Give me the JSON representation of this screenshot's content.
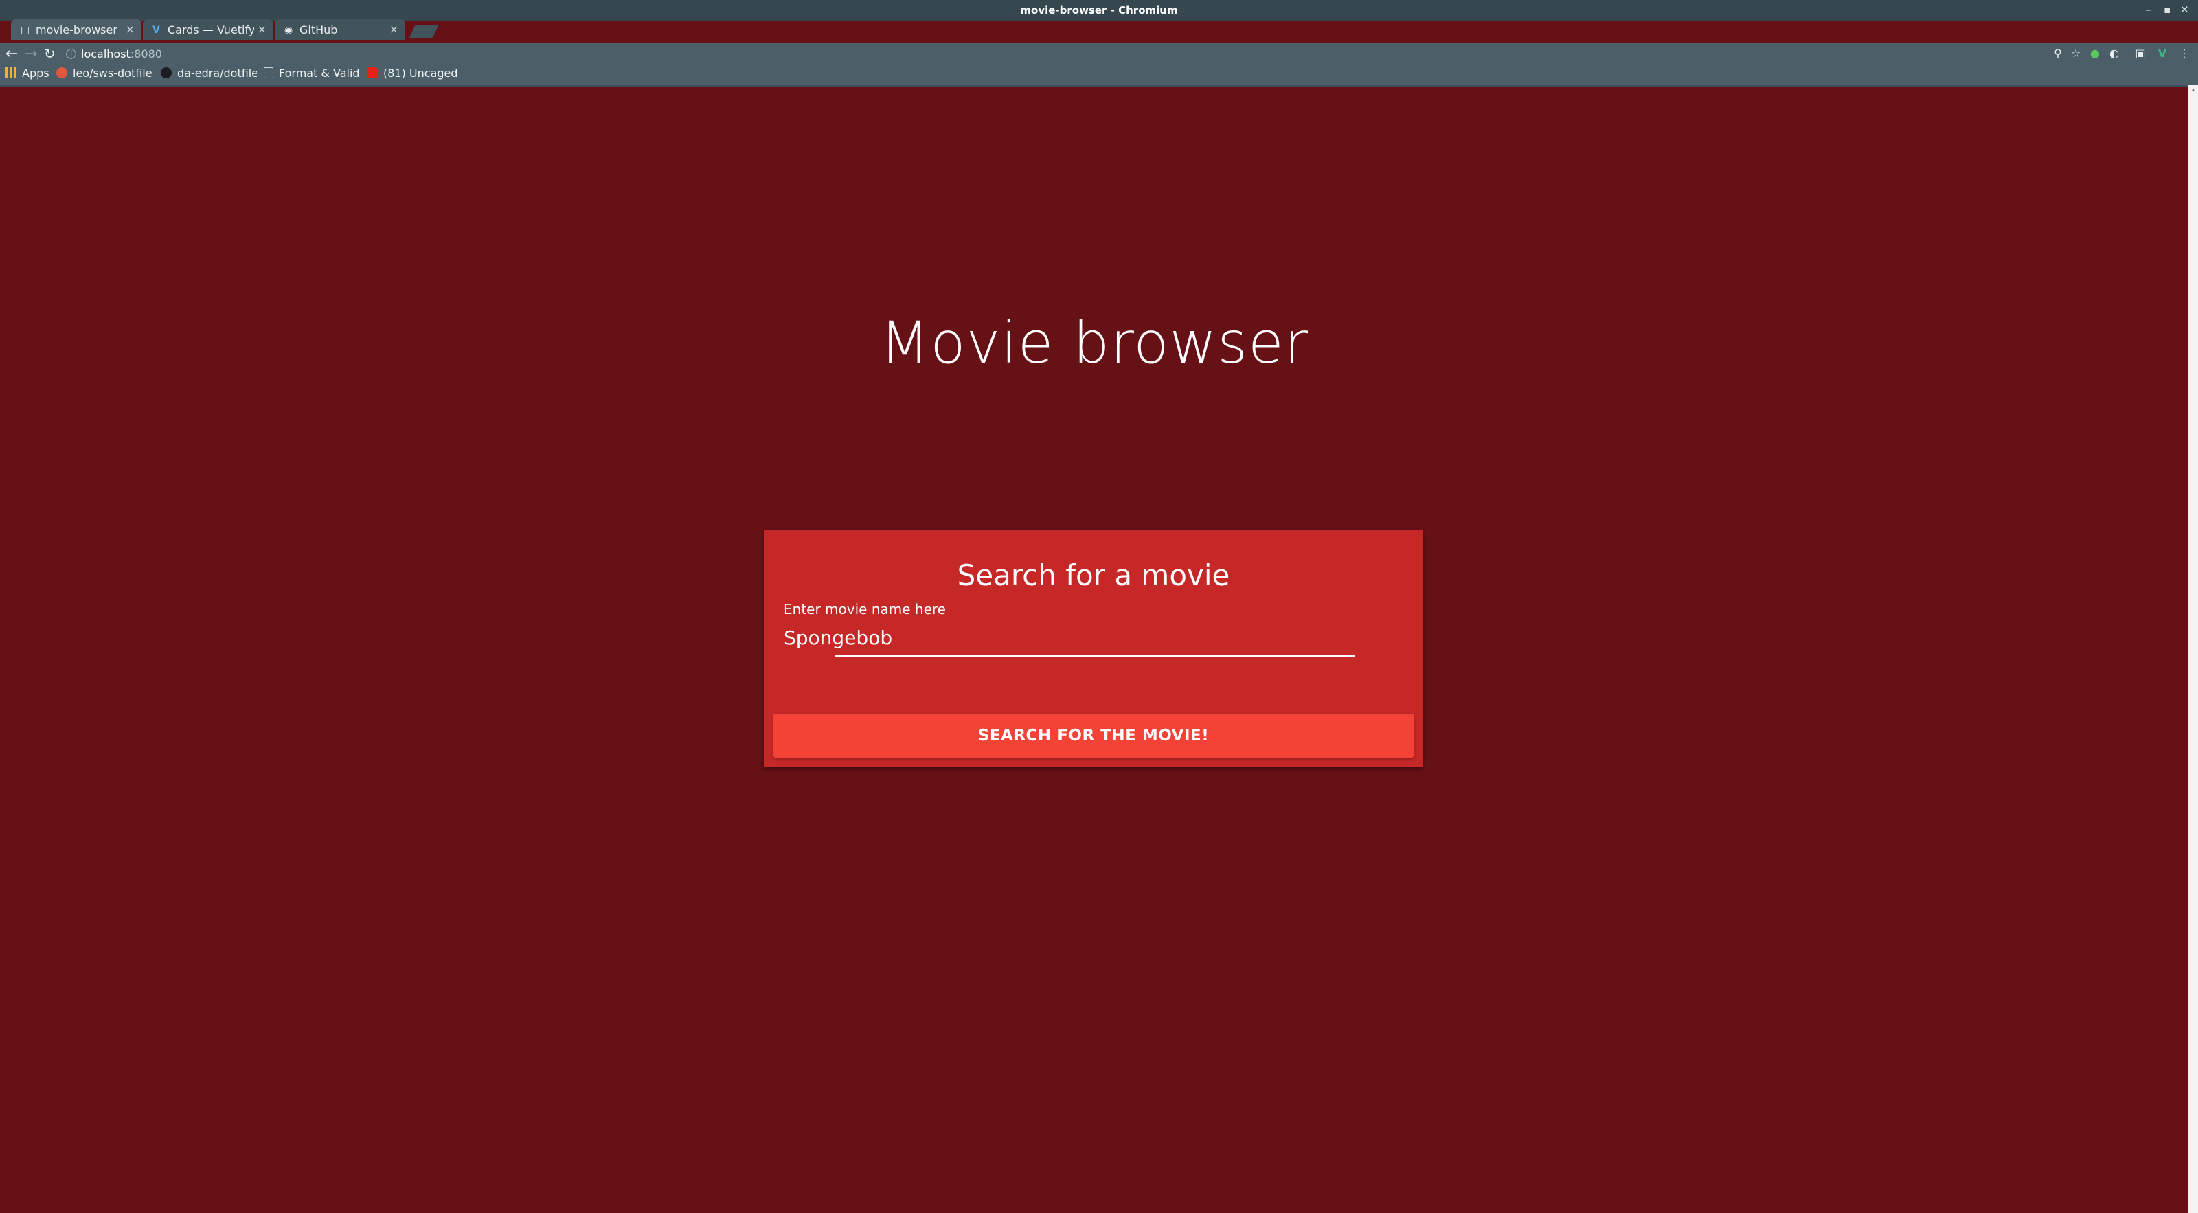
{
  "window": {
    "title": "movie-browser - Chromium"
  },
  "tabs": [
    {
      "label": "movie-browser",
      "icon": "document-icon",
      "active": true
    },
    {
      "label": "Cards — Vuetify.js",
      "icon": "vuetify-icon",
      "active": false
    },
    {
      "label": "GitHub",
      "icon": "github-icon",
      "active": false
    }
  ],
  "toolbar": {
    "url_host": "localhost",
    "url_port": ":8080"
  },
  "bookmarks": [
    {
      "label": "Apps",
      "icon": "apps-grid-icon"
    },
    {
      "label": "leo/sws-dotfiles",
      "icon": "gitlab-icon"
    },
    {
      "label": "da-edra/dotfiles",
      "icon": "github-icon"
    },
    {
      "label": "Format & Validate",
      "icon": "document-icon"
    },
    {
      "label": "(81) Uncaged",
      "icon": "youtube-icon"
    }
  ],
  "page": {
    "title": "Movie browser",
    "card": {
      "title": "Search for a movie",
      "input_label": "Enter movie name here",
      "input_value": "Spongebob",
      "button_label": "SEARCH FOR THE MOVIE!"
    }
  },
  "colors": {
    "background": "#651116",
    "card": "#c62828",
    "button": "#f44336",
    "chrome_titlebar": "#36474f",
    "chrome_toolbar": "#4c5f68"
  }
}
